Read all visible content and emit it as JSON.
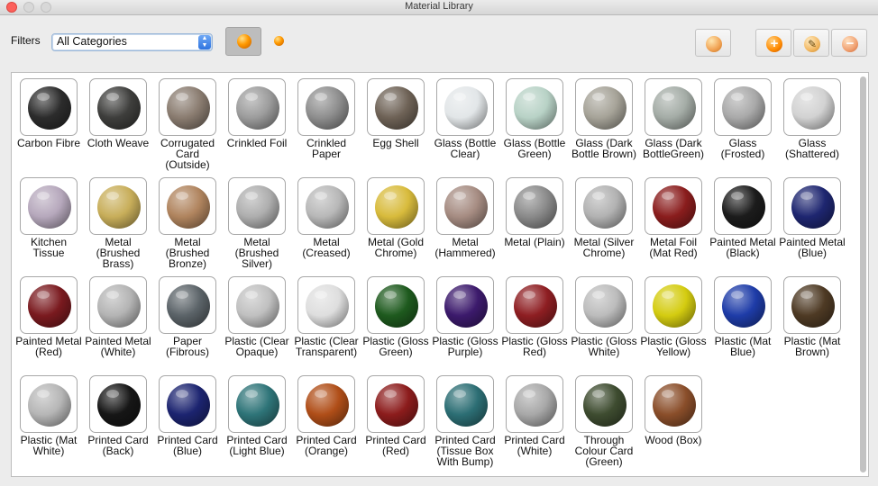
{
  "window": {
    "title": "Material Library"
  },
  "toolbar": {
    "filters_label": "Filters",
    "category_value": "All Categories",
    "icons": [
      "large-sphere-view-icon",
      "small-sphere-view-icon",
      "import-material-icon",
      "add-material-icon",
      "edit-material-icon",
      "remove-material-icon"
    ]
  },
  "materials": [
    {
      "name": "Carbon Fibre",
      "color": "#2c2c2c"
    },
    {
      "name": "Cloth Weave",
      "color": "#3e3e3c"
    },
    {
      "name": "Corrugated Card (Outside)",
      "color": "#8a7c70"
    },
    {
      "name": "Crinkled Foil",
      "color": "#9c9c9c"
    },
    {
      "name": "Crinkled Paper",
      "color": "#8e8e8e"
    },
    {
      "name": "Egg Shell",
      "color": "#6e6256"
    },
    {
      "name": "Glass (Bottle Clear)",
      "color": "#e2e6e8"
    },
    {
      "name": "Glass (Bottle Green)",
      "color": "#b8d2c6"
    },
    {
      "name": "Glass (Dark Bottle Brown)",
      "color": "#a6a398"
    },
    {
      "name": "Glass (Dark BottleGreen)",
      "color": "#a4aca6"
    },
    {
      "name": "Glass (Frosted)",
      "color": "#a9a9a9"
    },
    {
      "name": "Glass (Shattered)",
      "color": "#d2d2d2"
    },
    {
      "name": "Kitchen Tissue",
      "color": "#b6a8bc"
    },
    {
      "name": "Metal (Brushed Brass)",
      "color": "#c8ae5a"
    },
    {
      "name": "Metal (Brushed Bronze)",
      "color": "#b0845e"
    },
    {
      "name": "Metal (Brushed Silver)",
      "color": "#aeaeae"
    },
    {
      "name": "Metal (Creased)",
      "color": "#b8b8b8"
    },
    {
      "name": "Metal (Gold Chrome)",
      "color": "#d8bb3c"
    },
    {
      "name": "Metal (Hammered)",
      "color": "#a68c82"
    },
    {
      "name": "Metal (Plain)",
      "color": "#8a8a8a"
    },
    {
      "name": "Metal (Silver Chrome)",
      "color": "#b2b2b2"
    },
    {
      "name": "Metal Foil (Mat Red)",
      "color": "#8a1d1d"
    },
    {
      "name": "Painted Metal (Black)",
      "color": "#1c1c1c"
    },
    {
      "name": "Painted Metal (Blue)",
      "color": "#1e2670"
    },
    {
      "name": "Painted Metal (Red)",
      "color": "#7a1a1f"
    },
    {
      "name": "Painted Metal (White)",
      "color": "#b4b4b4"
    },
    {
      "name": "Paper (Fibrous)",
      "color": "#5b6368"
    },
    {
      "name": "Plastic (Clear Opaque)",
      "color": "#c0c0c0"
    },
    {
      "name": "Plastic (Clear Transparent)",
      "color": "#dedede"
    },
    {
      "name": "Plastic (Gloss Green)",
      "color": "#1e5a1e"
    },
    {
      "name": "Plastic (Gloss Purple)",
      "color": "#3c1a6c"
    },
    {
      "name": "Plastic (Gloss Red)",
      "color": "#8e1e22"
    },
    {
      "name": "Plastic (Gloss White)",
      "color": "#bcbcbc"
    },
    {
      "name": "Plastic (Gloss Yellow)",
      "color": "#d4cc10"
    },
    {
      "name": "Plastic (Mat Blue)",
      "color": "#1e3ca8"
    },
    {
      "name": "Plastic (Mat Brown)",
      "color": "#4e3a24"
    },
    {
      "name": "Plastic (Mat White)",
      "color": "#b6b6b6"
    },
    {
      "name": "Printed Card (Back)",
      "color": "#161616"
    },
    {
      "name": "Printed Card (Blue)",
      "color": "#1c2470"
    },
    {
      "name": "Printed Card (Light Blue)",
      "color": "#2e7478"
    },
    {
      "name": "Printed Card (Orange)",
      "color": "#b04e18"
    },
    {
      "name": "Printed Card (Red)",
      "color": "#8c1c1c"
    },
    {
      "name": "Printed Card (Tissue Box With Bump)",
      "color": "#2c6e74"
    },
    {
      "name": "Printed Card (White)",
      "color": "#a8a8a8"
    },
    {
      "name": "Through Colour Card (Green)",
      "color": "#3e4c30"
    },
    {
      "name": "Wood (Box)",
      "color": "#8a4e2a"
    }
  ]
}
